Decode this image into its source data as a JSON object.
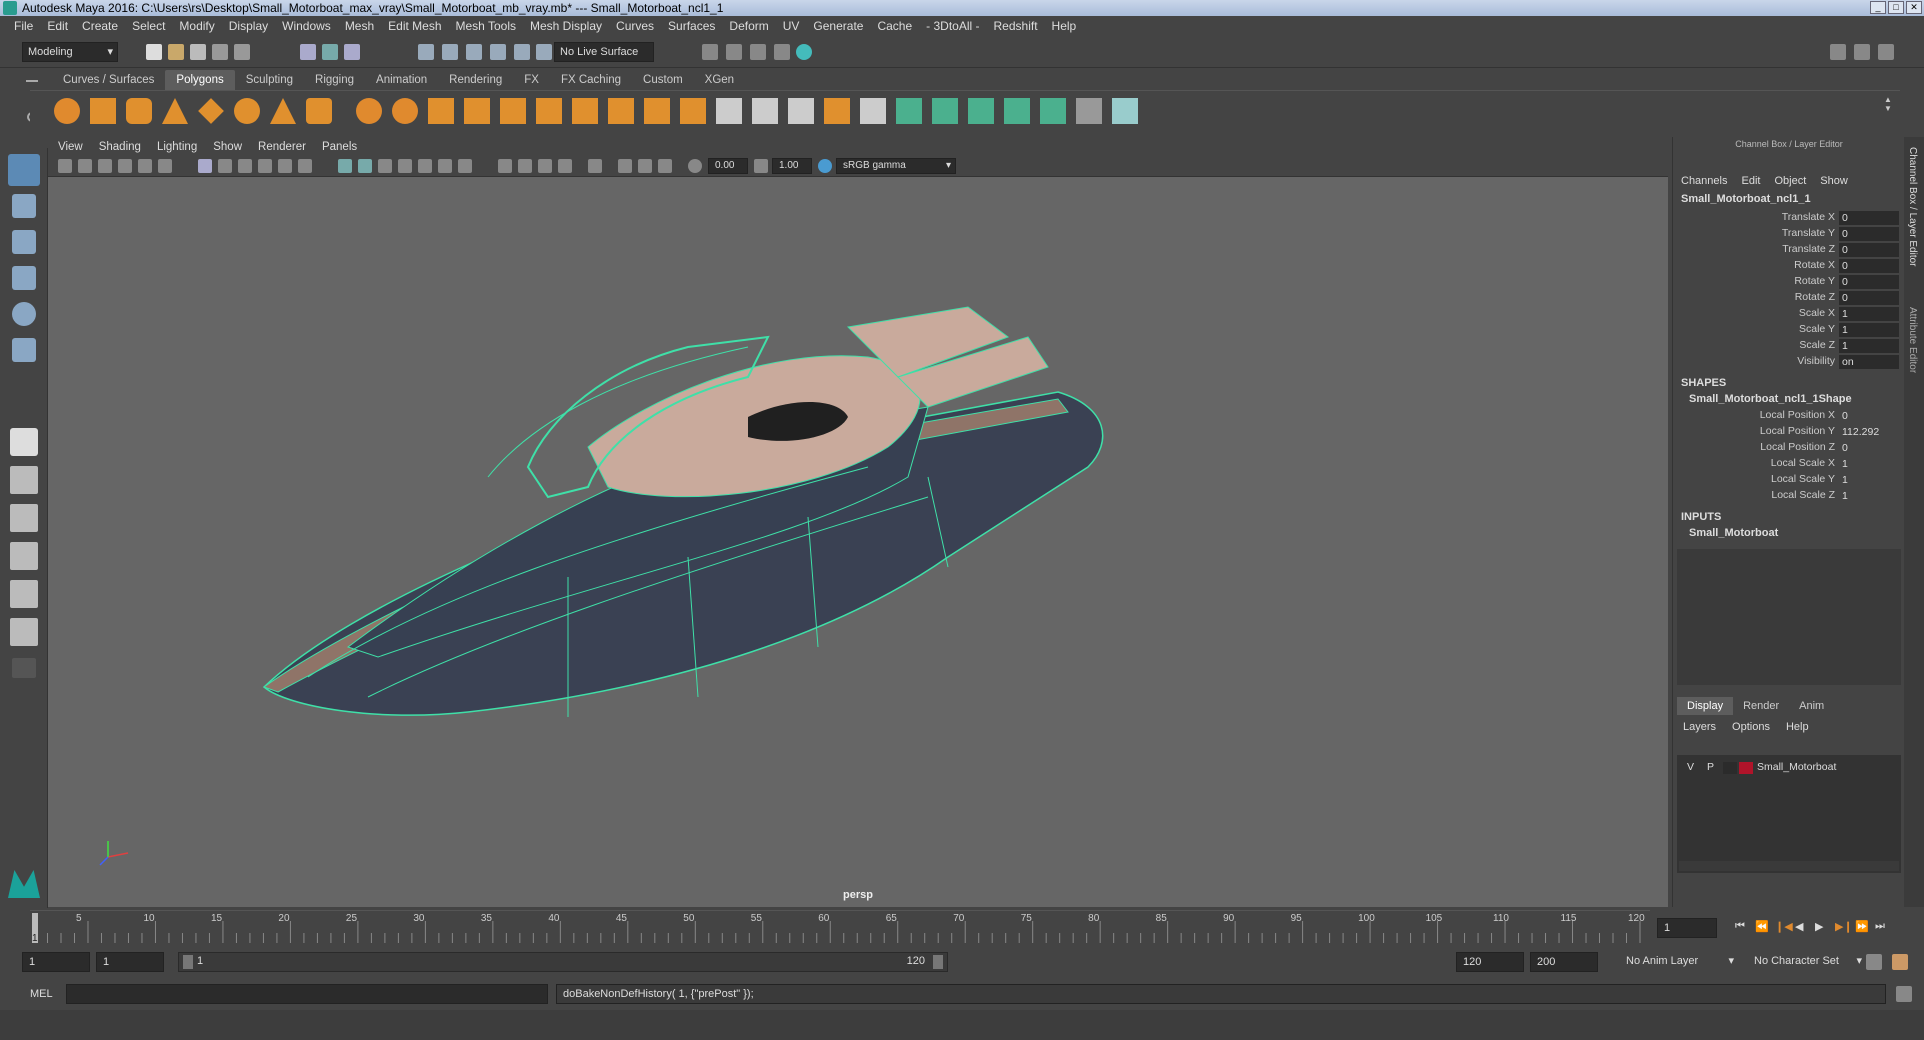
{
  "title": "Autodesk Maya 2016: C:\\Users\\rs\\Desktop\\Small_Motorboat_max_vray\\Small_Motorboat_mb_vray.mb*  ---  Small_Motorboat_ncl1_1",
  "window_buttons": [
    "_",
    "□",
    "✕"
  ],
  "menu": [
    "File",
    "Edit",
    "Create",
    "Select",
    "Modify",
    "Display",
    "Windows",
    "Mesh",
    "Edit Mesh",
    "Mesh Tools",
    "Mesh Display",
    "Curves",
    "Surfaces",
    "Deform",
    "UV",
    "Generate",
    "Cache",
    "- 3DtoAll -",
    "Redshift",
    "Help"
  ],
  "status": {
    "mode": "Modeling",
    "live_surface": "No Live Surface"
  },
  "shelf_tabs": [
    "Curves / Surfaces",
    "Polygons",
    "Sculpting",
    "Rigging",
    "Animation",
    "Rendering",
    "FX",
    "FX Caching",
    "Custom",
    "XGen"
  ],
  "viewport": {
    "menu": [
      "View",
      "Shading",
      "Lighting",
      "Show",
      "Renderer",
      "Panels"
    ],
    "exposure": "0.00",
    "gamma": "1.00",
    "colorspace": "sRGB gamma",
    "camera": "persp"
  },
  "channelbox": {
    "header": "Channel Box / Layer Editor",
    "menu": [
      "Channels",
      "Edit",
      "Object",
      "Show"
    ],
    "object": "Small_Motorboat_ncl1_1",
    "channels": [
      {
        "label": "Translate X",
        "value": "0"
      },
      {
        "label": "Translate Y",
        "value": "0"
      },
      {
        "label": "Translate Z",
        "value": "0"
      },
      {
        "label": "Rotate X",
        "value": "0"
      },
      {
        "label": "Rotate Y",
        "value": "0"
      },
      {
        "label": "Rotate Z",
        "value": "0"
      },
      {
        "label": "Scale X",
        "value": "1"
      },
      {
        "label": "Scale Y",
        "value": "1"
      },
      {
        "label": "Scale Z",
        "value": "1"
      },
      {
        "label": "Visibility",
        "value": "on"
      }
    ],
    "shapes_header": "SHAPES",
    "shape_name": "Small_Motorboat_ncl1_1Shape",
    "shape_channels": [
      {
        "label": "Local Position X",
        "value": "0"
      },
      {
        "label": "Local Position Y",
        "value": "112.292"
      },
      {
        "label": "Local Position Z",
        "value": "0"
      },
      {
        "label": "Local Scale X",
        "value": "1"
      },
      {
        "label": "Local Scale Y",
        "value": "1"
      },
      {
        "label": "Local Scale Z",
        "value": "1"
      }
    ],
    "inputs_header": "INPUTS",
    "input_name": "Small_Motorboat"
  },
  "layer_editor": {
    "tabs": [
      "Display",
      "Render",
      "Anim"
    ],
    "menu": [
      "Layers",
      "Options",
      "Help"
    ],
    "layer": {
      "v": "V",
      "p": "P",
      "name": "Small_Motorboat",
      "color": "#b0142a"
    }
  },
  "side_tabs": [
    "Channel Box / Layer Editor",
    "Attribute Editor"
  ],
  "timeline": {
    "ticks": [
      "5",
      "10",
      "15",
      "20",
      "25",
      "30",
      "35",
      "40",
      "45",
      "50",
      "55",
      "60",
      "65",
      "70",
      "75",
      "80",
      "85",
      "90",
      "95",
      "100",
      "105",
      "110",
      "115",
      "120"
    ],
    "start_label": "1",
    "current_frame": "1"
  },
  "range": {
    "start": "1",
    "start2": "1",
    "slider_start": "1",
    "slider_end": "120",
    "end": "120",
    "end2": "200",
    "anim_layer": "No Anim Layer",
    "char_set": "No Character Set"
  },
  "cmd": {
    "label": "MEL",
    "output": "doBakeNonDefHistory( 1, {\"prePost\" });"
  }
}
